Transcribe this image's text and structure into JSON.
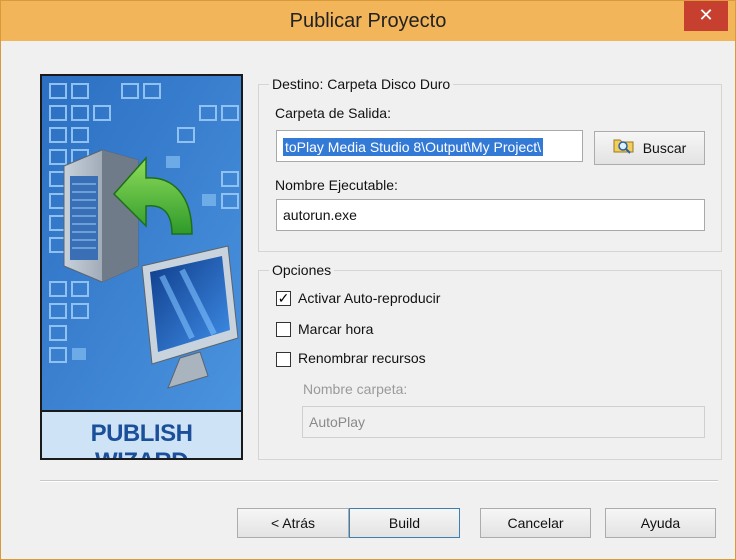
{
  "window": {
    "title": "Publicar Proyecto",
    "close_glyph": "✕"
  },
  "banner": {
    "text": "PUBLISH WIZARD"
  },
  "destination": {
    "group_label": "Destino: Carpeta Disco Duro",
    "output_folder_label": "Carpeta de Salida:",
    "output_folder_value": "toPlay Media Studio 8\\Output\\My Project\\",
    "browse_label": "Buscar",
    "exe_name_label": "Nombre Ejecutable:",
    "exe_name_value": "autorun.exe"
  },
  "options": {
    "group_label": "Opciones",
    "autoplay": {
      "label": "Activar Auto-reproducir",
      "checked": true
    },
    "timestamp": {
      "label": "Marcar hora",
      "checked": false
    },
    "rename": {
      "label": "Renombrar recursos",
      "checked": false
    },
    "folder_name_label": "Nombre carpeta:",
    "folder_name_value": "AutoPlay"
  },
  "buttons": {
    "back": "< Atrás",
    "build": "Build",
    "cancel": "Cancelar",
    "help": "Ayuda"
  }
}
